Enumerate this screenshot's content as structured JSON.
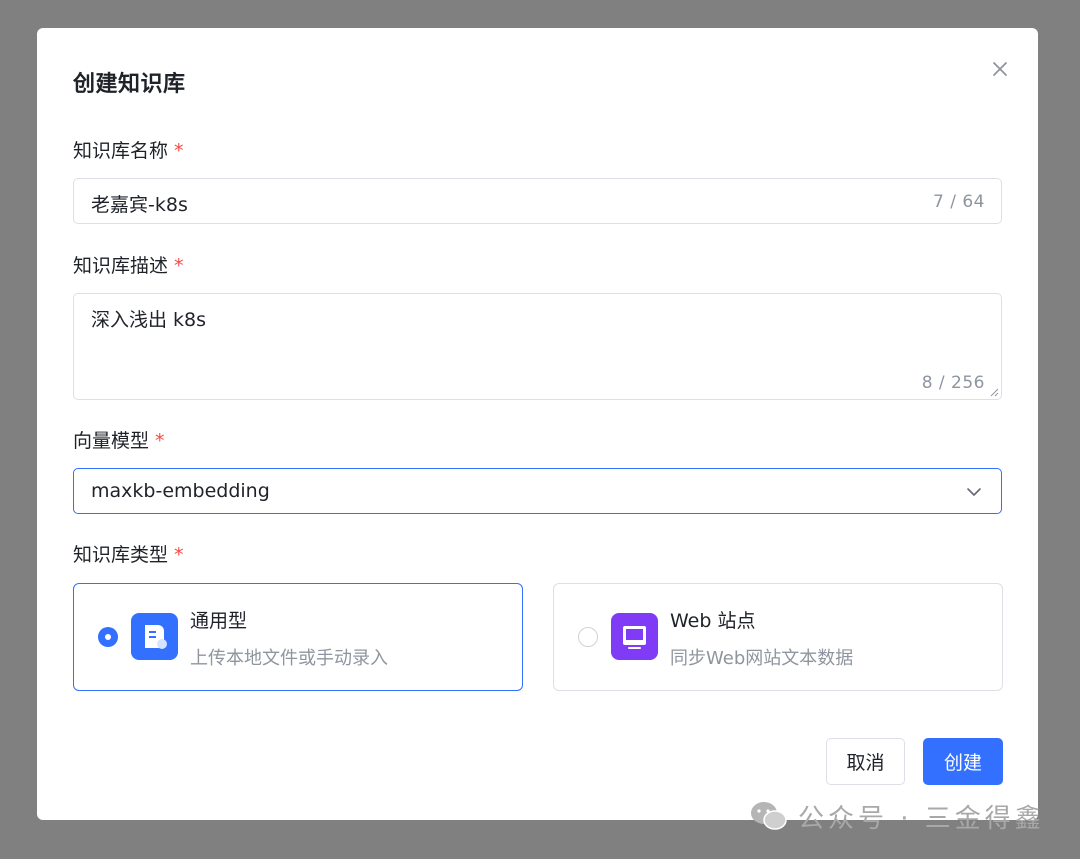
{
  "dialog": {
    "title": "创建知识库",
    "close_icon": "close-icon"
  },
  "fields": {
    "name": {
      "label": "知识库名称",
      "required_mark": "*",
      "value": "老嘉宾-k8s",
      "counter": "7 / 64"
    },
    "description": {
      "label": "知识库描述",
      "required_mark": "*",
      "value": "深入浅出 k8s",
      "counter": "8 / 256"
    },
    "vector_model": {
      "label": "向量模型",
      "required_mark": "*",
      "selected_value": "maxkb-embedding",
      "dropdown_icon": "chevron-down-icon"
    },
    "kb_type": {
      "label": "知识库类型",
      "required_mark": "*",
      "options": [
        {
          "title": "通用型",
          "description": "上传本地文件或手动录入",
          "icon": "document-icon",
          "icon_color": "#3370ff",
          "selected": true
        },
        {
          "title": "Web 站点",
          "description": "同步Web网站文本数据",
          "icon": "monitor-icon",
          "icon_color": "#7f3bf5",
          "selected": false
        }
      ]
    }
  },
  "footer": {
    "cancel_label": "取消",
    "create_label": "创建"
  },
  "watermark": {
    "text": "公众号 · 三金得鑫",
    "icon": "wechat-icon"
  },
  "colors": {
    "accent": "#3370ff",
    "required": "#f54a45",
    "overlay": "#808080",
    "muted_text": "#8f959e"
  }
}
